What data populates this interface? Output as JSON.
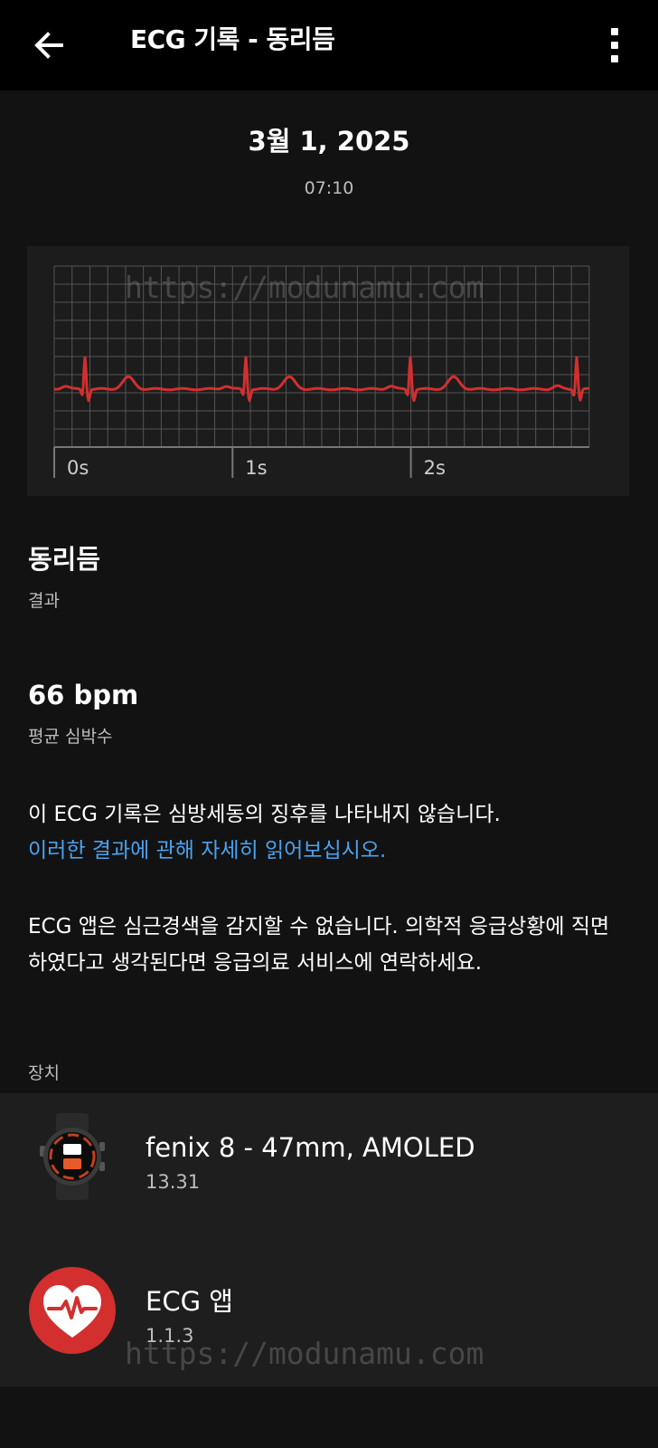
{
  "appbar": {
    "back_icon": "arrow-left-icon",
    "title": "ECG 기록 - 동리듬",
    "menu_icon": "more-vertical-icon"
  },
  "record": {
    "date": "3월 1, 2025",
    "time": "07:10"
  },
  "ecg_chart": {
    "x_ticks": [
      "0s",
      "1s",
      "2s"
    ],
    "trace_color": "#d32f2f",
    "grid_color": "#555555"
  },
  "result": {
    "value": "동리듬",
    "label": "결과"
  },
  "heart_rate": {
    "value": "66 bpm",
    "label": "평균 심박수"
  },
  "description": {
    "statement": "이 ECG 기록은 심방세동의 징후를 나타내지 않습니다.",
    "link_text": "이러한 결과에 관해 자세히 읽어보십시오.",
    "disclaimer": "ECG 앱은 심근경색을 감지할 수 없습니다. 의학적 응급상황에 직면하였다고 생각된다면 응급의료 서비스에 연락하세요."
  },
  "devices": {
    "section_label": "장치",
    "items": [
      {
        "name": "fenix 8 - 47mm, AMOLED",
        "version": "13.31",
        "icon": "watch-icon"
      },
      {
        "name": "ECG 앱",
        "version": "1.1.3",
        "icon": "heart-pulse-icon"
      }
    ]
  },
  "watermark": "https://modunamu.com",
  "colors": {
    "background": "#121212",
    "appbar": "#000000",
    "link": "#4aa3f0",
    "heart_badge": "#d32f2f"
  }
}
